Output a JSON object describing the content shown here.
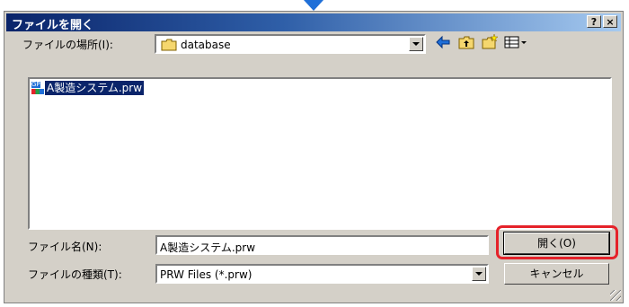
{
  "dialog": {
    "title": "ファイルを開く",
    "help_label": "?",
    "close_label": "×"
  },
  "location": {
    "label": "ファイルの場所(I):",
    "value": "database"
  },
  "toolbar": {
    "back_icon": "arrow-left-icon",
    "up_icon": "folder-up-icon",
    "new_folder_icon": "new-folder-icon",
    "view_icon": "view-menu-icon"
  },
  "files": [
    {
      "icon_text": "GP",
      "name": "A製造システム.prw",
      "selected": true
    }
  ],
  "filename": {
    "label": "ファイル名(N):",
    "value": "A製造システム.prw"
  },
  "filetype": {
    "label": "ファイルの種類(T):",
    "value": "PRW Files (*.prw)"
  },
  "buttons": {
    "open": "開く(O)",
    "cancel": "キャンセル"
  },
  "colors": {
    "title_bar": "#0a246a",
    "highlight": "#e5222a",
    "pointer_arrow": "#1f6fd8",
    "selection": "#0a246a"
  }
}
